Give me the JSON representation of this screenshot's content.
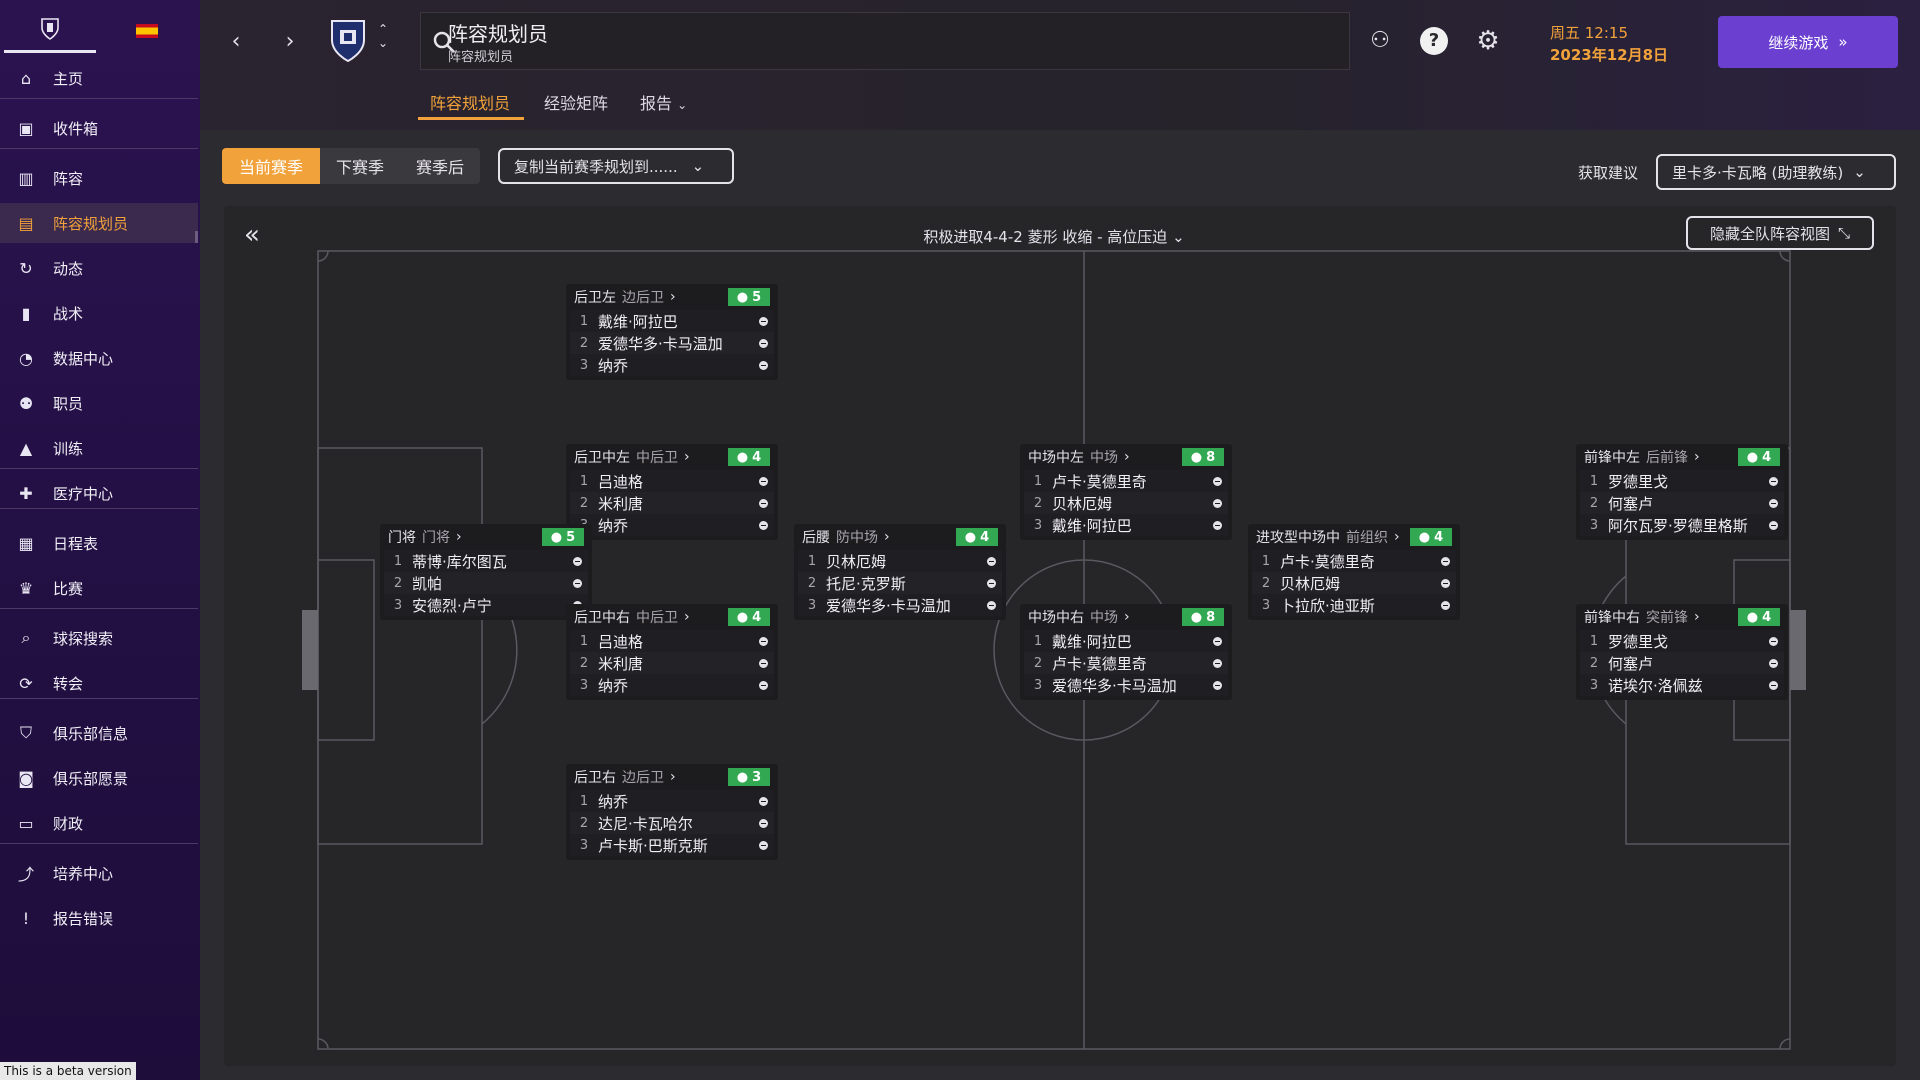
{
  "sidebar": {
    "items": [
      {
        "label": "主页",
        "icon": "home-icon"
      },
      {
        "label": "收件箱",
        "icon": "inbox-icon"
      },
      {
        "label": "阵容",
        "icon": "squad-icon"
      },
      {
        "label": "阵容规划员",
        "icon": "clipboard-icon"
      },
      {
        "label": "动态",
        "icon": "dynamics-icon"
      },
      {
        "label": "战术",
        "icon": "tactics-icon"
      },
      {
        "label": "数据中心",
        "icon": "data-hub-icon"
      },
      {
        "label": "职员",
        "icon": "staff-icon"
      },
      {
        "label": "训练",
        "icon": "training-icon"
      },
      {
        "label": "医疗中心",
        "icon": "medical-icon"
      },
      {
        "label": "日程表",
        "icon": "calendar-icon"
      },
      {
        "label": "比赛",
        "icon": "trophy-icon"
      },
      {
        "label": "球探搜索",
        "icon": "search-icon"
      },
      {
        "label": "转会",
        "icon": "transfer-icon"
      },
      {
        "label": "俱乐部信息",
        "icon": "shield-icon"
      },
      {
        "label": "俱乐部愿景",
        "icon": "briefcase-icon"
      },
      {
        "label": "财政",
        "icon": "finance-icon"
      },
      {
        "label": "培养中心",
        "icon": "development-icon"
      },
      {
        "label": "报告错误",
        "icon": "alert-icon"
      }
    ],
    "beta_text": "This is a beta version"
  },
  "header": {
    "title": "阵容规划员",
    "subtitle": "阵容规划员",
    "date_day": "周五 12:15",
    "date_full": "2023年12月8日",
    "continue_label": "继续游戏"
  },
  "tabs": [
    {
      "label": "阵容规划员"
    },
    {
      "label": "经验矩阵"
    },
    {
      "label": "报告"
    }
  ],
  "toolbar": {
    "seasons": [
      "当前赛季",
      "下赛季",
      "赛季后"
    ],
    "copy_label": "复制当前赛季规划到......",
    "advice_label": "获取建议",
    "advisor": "里卡多·卡瓦略 (助理教练)"
  },
  "panel": {
    "formation": "积极进取4-4-2 菱形 收缩 - 高位压迫",
    "hide_label": "隐藏全队阵容视图"
  },
  "positions": [
    {
      "name": "后卫左",
      "role": "边后卫",
      "count": "5",
      "players": [
        "戴维·阿拉巴",
        "爱德华多·卡马温加",
        "纳乔"
      ]
    },
    {
      "name": "后卫中左",
      "role": "中后卫",
      "count": "4",
      "players": [
        "吕迪格",
        "米利唐",
        "纳乔"
      ]
    },
    {
      "name": "门将",
      "role": "门将",
      "count": "5",
      "players": [
        "蒂博·库尔图瓦",
        "凯帕",
        "安德烈·卢宁"
      ]
    },
    {
      "name": "后卫中右",
      "role": "中后卫",
      "count": "4",
      "players": [
        "吕迪格",
        "米利唐",
        "纳乔"
      ]
    },
    {
      "name": "后卫右",
      "role": "边后卫",
      "count": "3",
      "players": [
        "纳乔",
        "达尼·卡瓦哈尔",
        "卢卡斯·巴斯克斯"
      ]
    },
    {
      "name": "后腰",
      "role": "防中场",
      "count": "4",
      "players": [
        "贝林厄姆",
        "托尼·克罗斯",
        "爱德华多·卡马温加"
      ]
    },
    {
      "name": "中场中左",
      "role": "中场",
      "count": "8",
      "players": [
        "卢卡·莫德里奇",
        "贝林厄姆",
        "戴维·阿拉巴"
      ]
    },
    {
      "name": "中场中右",
      "role": "中场",
      "count": "8",
      "players": [
        "戴维·阿拉巴",
        "卢卡·莫德里奇",
        "爱德华多·卡马温加"
      ]
    },
    {
      "name": "进攻型中场中",
      "role": "前组织",
      "count": "4",
      "players": [
        "卢卡·莫德里奇",
        "贝林厄姆",
        "卜拉欣·迪亚斯"
      ]
    },
    {
      "name": "前锋中左",
      "role": "后前锋",
      "count": "4",
      "players": [
        "罗德里戈",
        "何塞卢",
        "阿尔瓦罗·罗德里格斯"
      ]
    },
    {
      "name": "前锋中右",
      "role": "突前锋",
      "count": "4",
      "players": [
        "罗德里戈",
        "何塞卢",
        "诺埃尔·洛佩兹"
      ]
    }
  ],
  "colors": {
    "accent": "#f2a23a",
    "continue": "#6b3fd0",
    "count_badge": "#32a852"
  }
}
